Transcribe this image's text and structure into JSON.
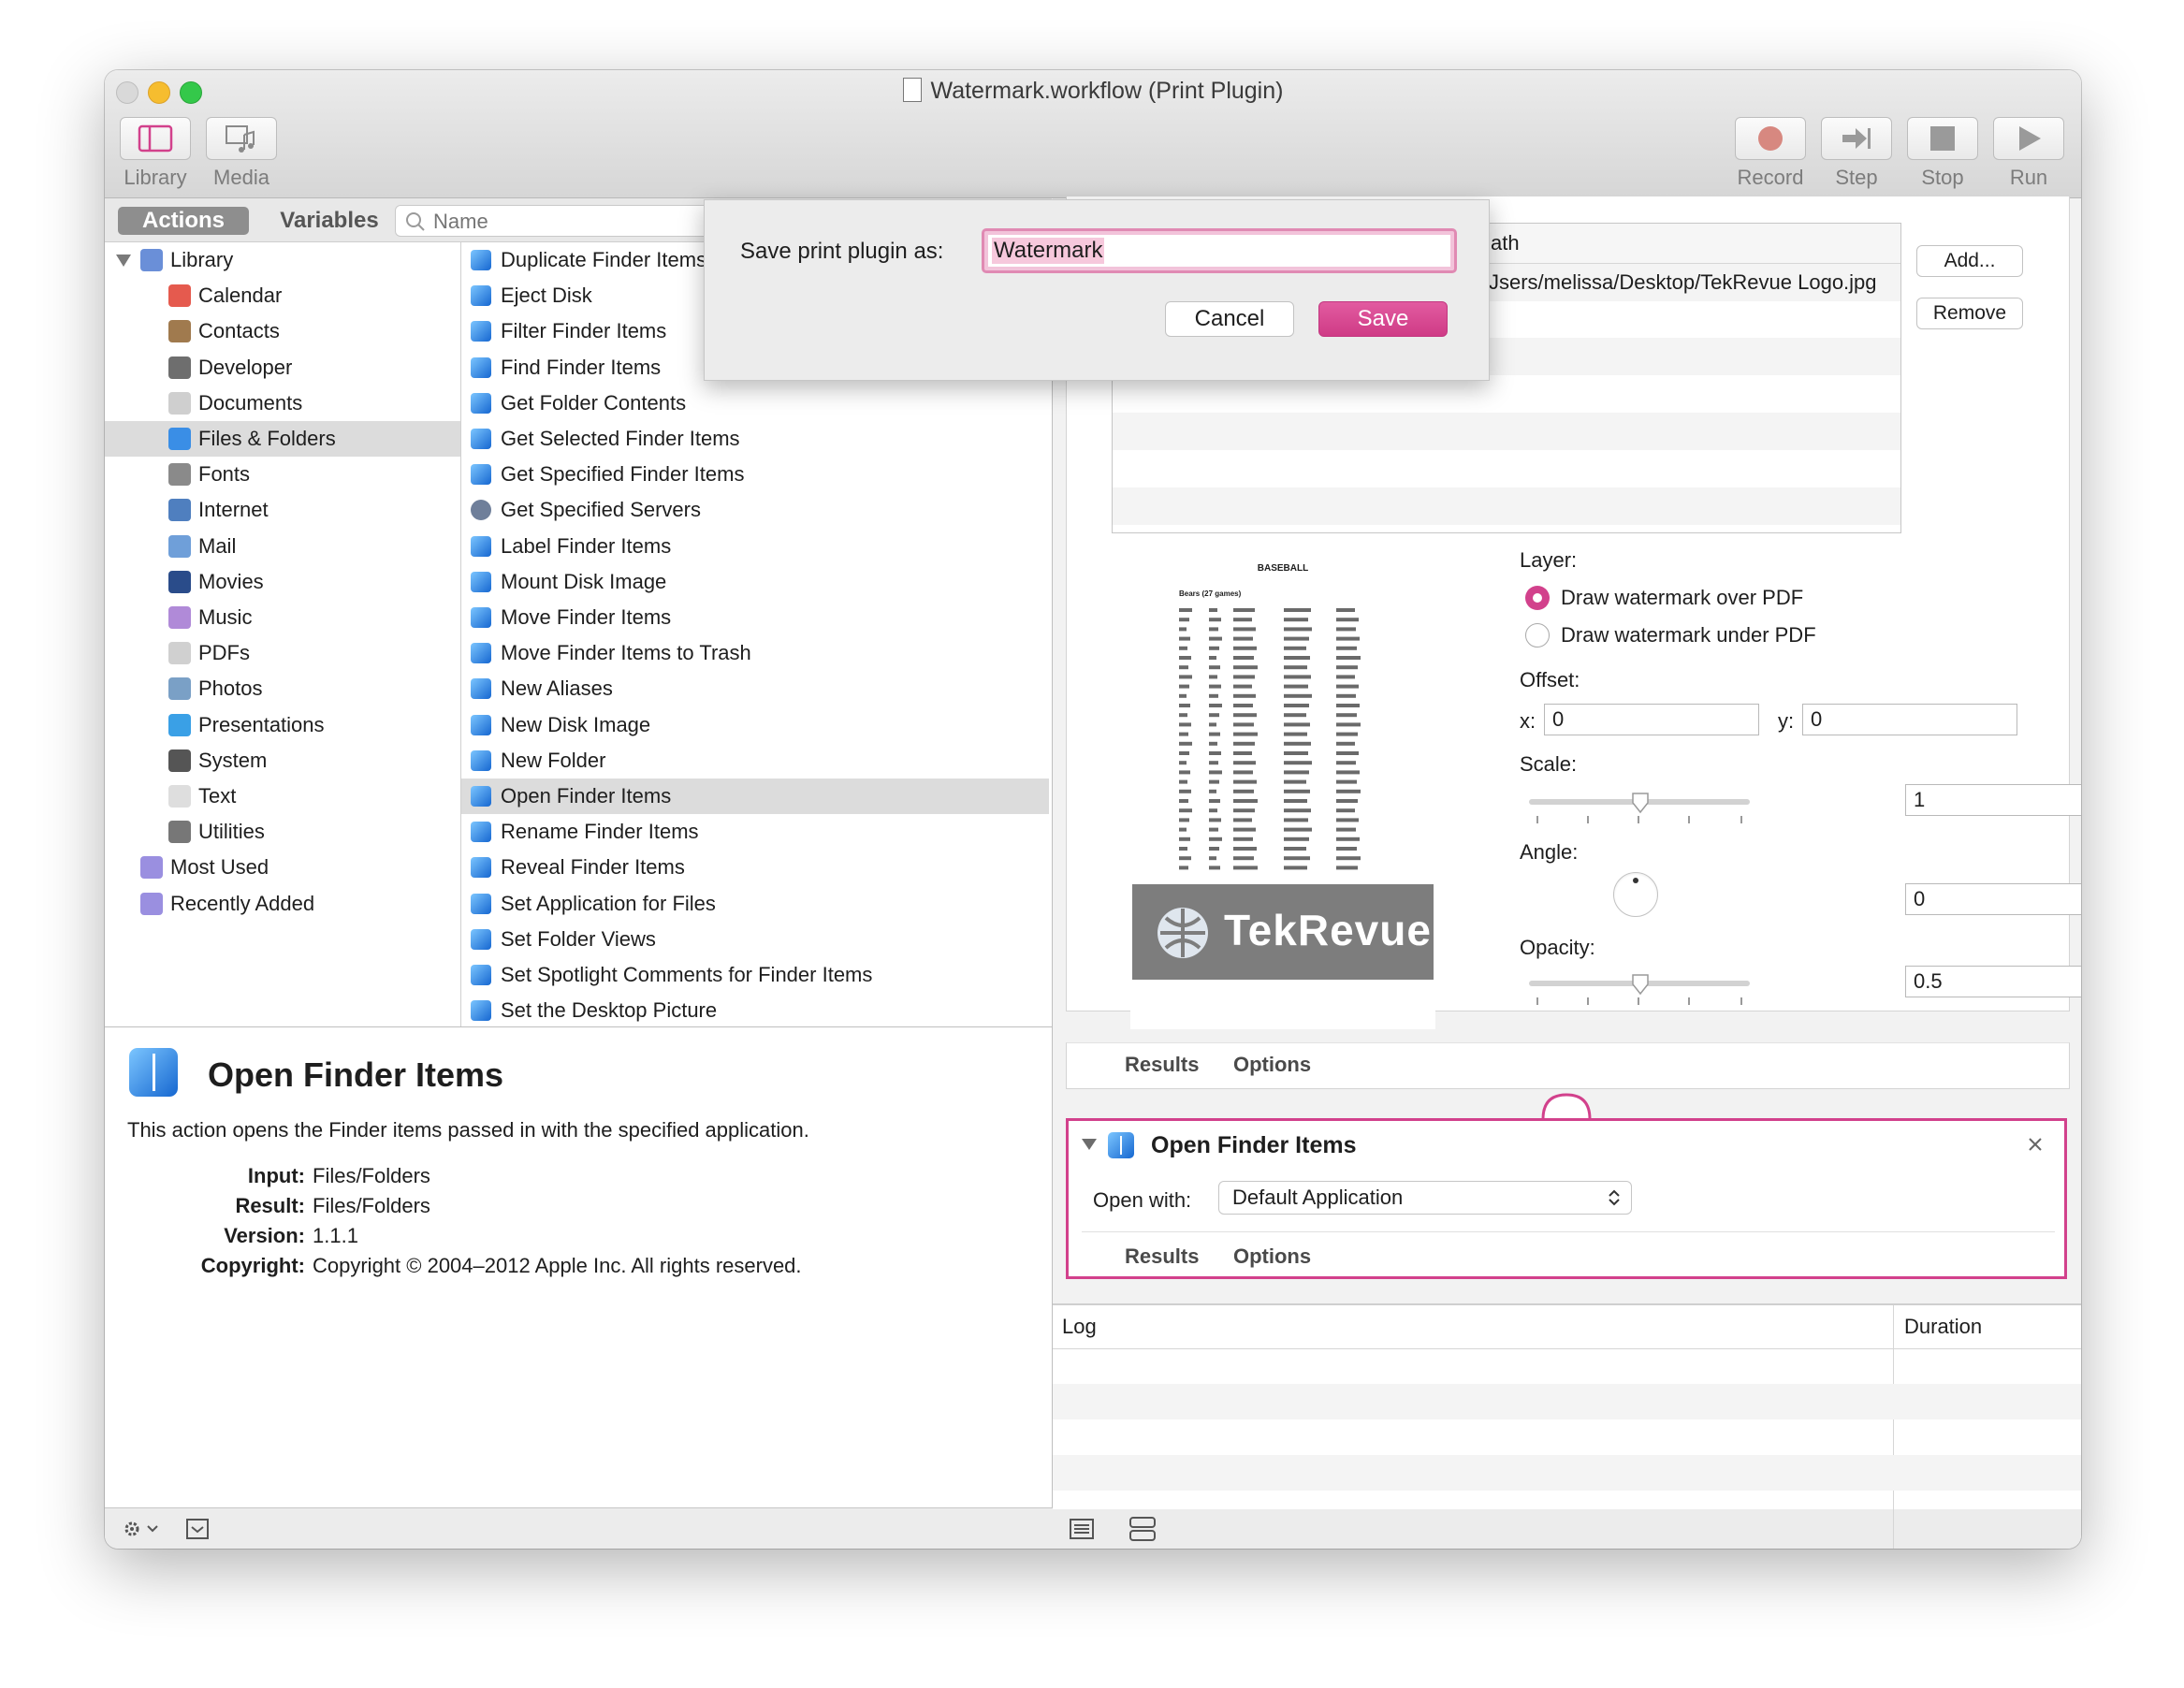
{
  "window": {
    "title": "Watermark.workflow (Print Plugin)"
  },
  "toolbar": {
    "left": [
      {
        "label": "Library",
        "icon": "sidebar-icon"
      },
      {
        "label": "Media",
        "icon": "media-icon"
      }
    ],
    "right": [
      {
        "label": "Record",
        "icon": "record-icon"
      },
      {
        "label": "Step",
        "icon": "step-icon"
      },
      {
        "label": "Stop",
        "icon": "stop-icon"
      },
      {
        "label": "Run",
        "icon": "run-icon"
      }
    ]
  },
  "tabs": {
    "actions": "Actions",
    "variables": "Variables"
  },
  "search": {
    "placeholder": "Name"
  },
  "library": {
    "items": [
      {
        "label": "Library",
        "level": 0,
        "icon": "library-icon"
      },
      {
        "label": "Calendar",
        "level": 1,
        "icon": "calendar-icon"
      },
      {
        "label": "Contacts",
        "level": 1,
        "icon": "contacts-icon"
      },
      {
        "label": "Developer",
        "level": 1,
        "icon": "developer-icon"
      },
      {
        "label": "Documents",
        "level": 1,
        "icon": "documents-icon"
      },
      {
        "label": "Files & Folders",
        "level": 1,
        "icon": "finder-icon",
        "selected": true
      },
      {
        "label": "Fonts",
        "level": 1,
        "icon": "fonts-icon"
      },
      {
        "label": "Internet",
        "level": 1,
        "icon": "internet-icon"
      },
      {
        "label": "Mail",
        "level": 1,
        "icon": "mail-icon"
      },
      {
        "label": "Movies",
        "level": 1,
        "icon": "movies-icon"
      },
      {
        "label": "Music",
        "level": 1,
        "icon": "music-icon"
      },
      {
        "label": "PDFs",
        "level": 1,
        "icon": "pdfs-icon"
      },
      {
        "label": "Photos",
        "level": 1,
        "icon": "photos-icon"
      },
      {
        "label": "Presentations",
        "level": 1,
        "icon": "presentations-icon"
      },
      {
        "label": "System",
        "level": 1,
        "icon": "system-icon"
      },
      {
        "label": "Text",
        "level": 1,
        "icon": "text-icon"
      },
      {
        "label": "Utilities",
        "level": 1,
        "icon": "utilities-icon"
      },
      {
        "label": "Most Used",
        "level": 0,
        "icon": "smart-folder-icon"
      },
      {
        "label": "Recently Added",
        "level": 0,
        "icon": "smart-folder-icon"
      }
    ]
  },
  "actions": {
    "items": [
      "Duplicate Finder Items",
      "Eject Disk",
      "Filter Finder Items",
      "Find Finder Items",
      "Get Folder Contents",
      "Get Selected Finder Items",
      "Get Specified Finder Items",
      "Get Specified Servers",
      "Label Finder Items",
      "Mount Disk Image",
      "Move Finder Items",
      "Move Finder Items to Trash",
      "New Aliases",
      "New Disk Image",
      "New Folder",
      "Open Finder Items",
      "Rename Finder Items",
      "Reveal Finder Items",
      "Set Application for Files",
      "Set Folder Views",
      "Set Spotlight Comments for Finder Items",
      "Set the Desktop Picture"
    ],
    "selected_index": 15
  },
  "description": {
    "title": "Open Finder Items",
    "text": "This action opens the Finder items passed in with the specified application.",
    "fields": [
      {
        "key": "Input:",
        "value": "Files/Folders"
      },
      {
        "key": "Result:",
        "value": "Files/Folders"
      },
      {
        "key": "Version:",
        "value": "1.1.1"
      },
      {
        "key": "Copyright:",
        "value": "Copyright © 2004–2012 Apple Inc.  All rights reserved."
      }
    ]
  },
  "watermark": {
    "path_header": "ath",
    "path_value": "Jsers/melissa/Desktop/TekRevue Logo.jpg",
    "add_label": "Add...",
    "remove_label": "Remove",
    "preview_heading": "BASEBALL",
    "preview_subheading": "Bears (27 games)",
    "logo_text": "TekRevue",
    "layer_label": "Layer:",
    "layer_over": "Draw watermark over PDF",
    "layer_under": "Draw watermark under PDF",
    "layer_selected": "over",
    "offset_label": "Offset:",
    "x_label": "x:",
    "x_value": "0",
    "y_label": "y:",
    "y_value": "0",
    "scale_label": "Scale:",
    "scale_value": "1",
    "angle_label": "Angle:",
    "angle_value": "0",
    "opacity_label": "Opacity:",
    "opacity_value": "0.5",
    "results_label": "Results",
    "options_label": "Options"
  },
  "open_finder": {
    "title": "Open Finder Items",
    "open_with_label": "Open with:",
    "open_with_value": "Default Application",
    "results_label": "Results",
    "options_label": "Options"
  },
  "log": {
    "log_header": "Log",
    "duration_header": "Duration"
  },
  "dialog": {
    "label": "Save print plugin as:",
    "value": "Watermark",
    "cancel": "Cancel",
    "save": "Save"
  },
  "colors": {
    "accent": "#d2418c",
    "selection": "#dcdcdc"
  }
}
